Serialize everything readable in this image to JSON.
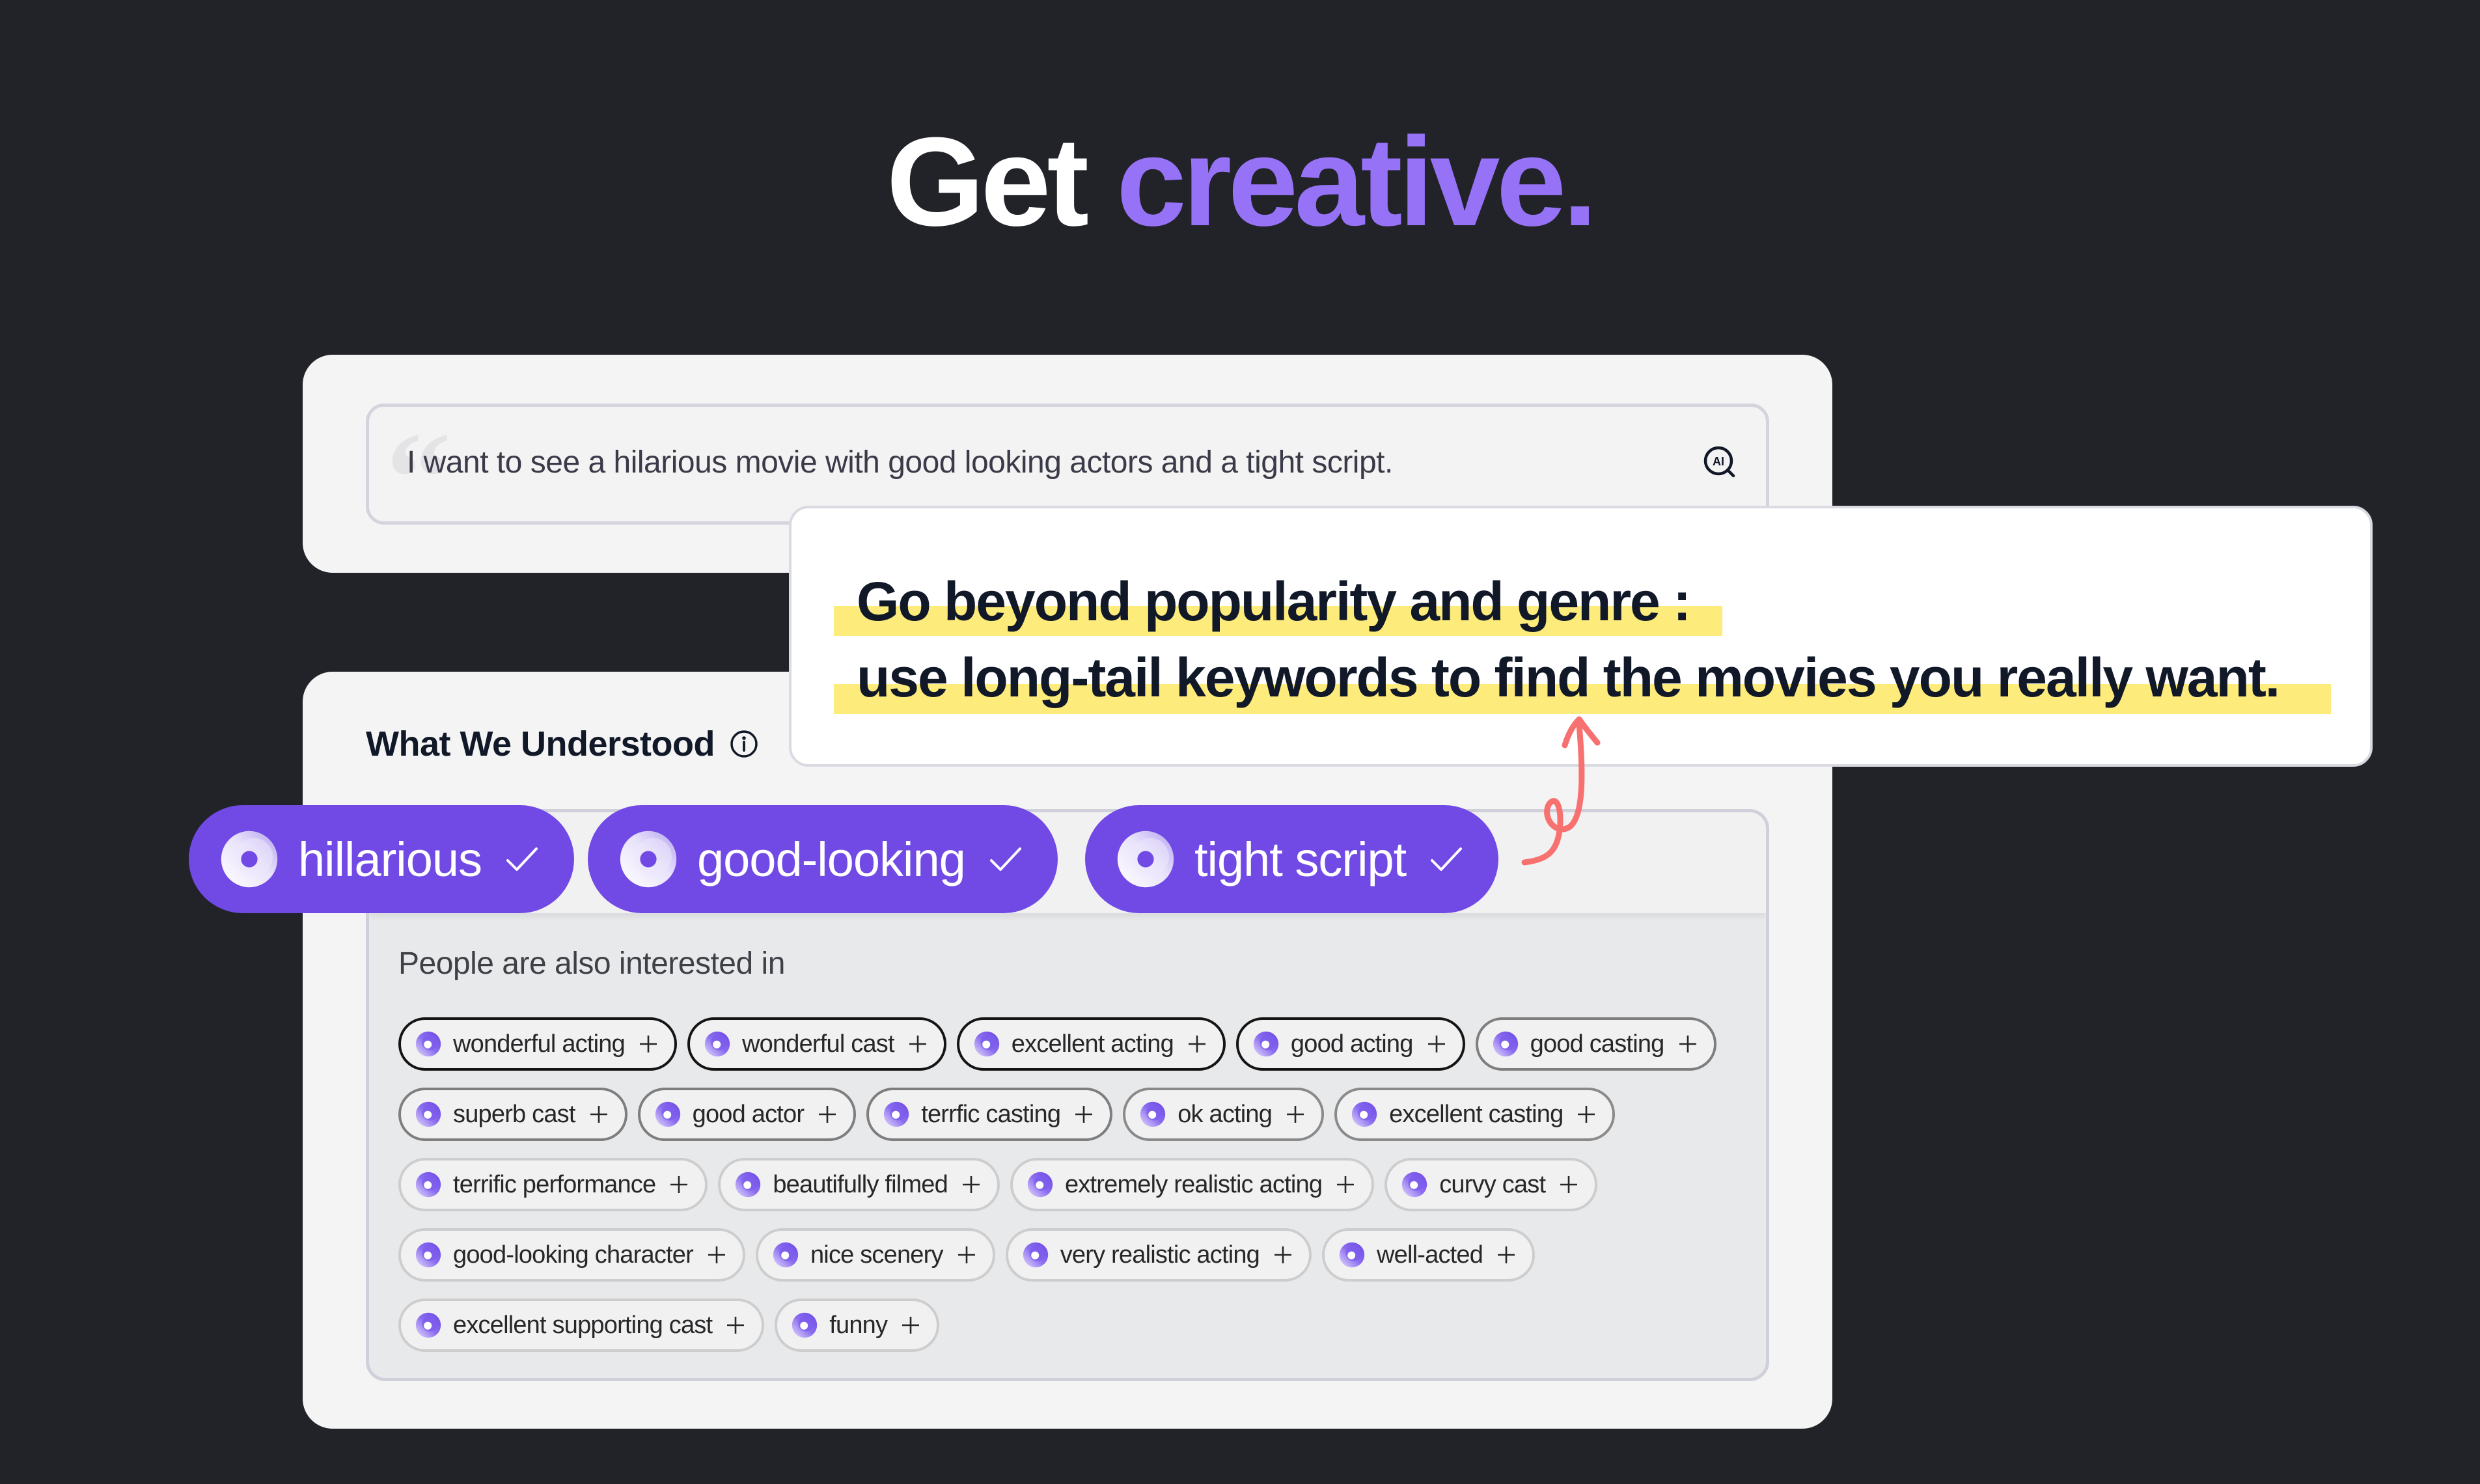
{
  "headline": {
    "plain": "Get ",
    "accent": "creative.",
    "accent_color": "#9672f7"
  },
  "query_card": {
    "quote_mark": "“",
    "query_text": "I want to see a hilarious movie with good looking actors and a tight script.",
    "ai_icon": "ai-search-icon",
    "ai_icon_label": "AI"
  },
  "callout": {
    "line_1": "Go beyond popularity and genre :",
    "line_2": "use long-tail keywords to find the movies you really want.",
    "highlight_color": "#fdeb7b",
    "arrow_color": "#f87171"
  },
  "understood": {
    "title": "What We Understood",
    "info_icon": "info-icon",
    "selected_tags": [
      {
        "label": "hillarious",
        "icon": "swirl-icon",
        "state": "checked"
      },
      {
        "label": "good-looking",
        "icon": "swirl-icon",
        "state": "checked"
      },
      {
        "label": "tight script",
        "icon": "swirl-icon",
        "state": "checked"
      }
    ],
    "tag_color": "#714ae6",
    "also_interested_label": "People are also interested in",
    "suggestions": [
      {
        "label": "wonderful acting",
        "action": "add"
      },
      {
        "label": "wonderful cast",
        "action": "add"
      },
      {
        "label": "excellent acting",
        "action": "add"
      },
      {
        "label": "good acting",
        "action": "add"
      },
      {
        "label": "good casting",
        "action": "add"
      },
      {
        "label": "superb cast",
        "action": "add"
      },
      {
        "label": "good actor",
        "action": "add"
      },
      {
        "label": "terrfic casting",
        "action": "add"
      },
      {
        "label": "ok acting",
        "action": "add"
      },
      {
        "label": "excellent casting",
        "action": "add"
      },
      {
        "label": "terrific performance",
        "action": "add"
      },
      {
        "label": "beautifully filmed",
        "action": "add"
      },
      {
        "label": "extremely realistic acting",
        "action": "add"
      },
      {
        "label": "curvy cast",
        "action": "add"
      },
      {
        "label": "good-looking character",
        "action": "add"
      },
      {
        "label": "nice scenery",
        "action": "add"
      },
      {
        "label": "very realistic acting",
        "action": "add"
      },
      {
        "label": "well-acted",
        "action": "add"
      },
      {
        "label": "excellent supporting cast",
        "action": "add"
      },
      {
        "label": "funny",
        "action": "add"
      }
    ]
  }
}
